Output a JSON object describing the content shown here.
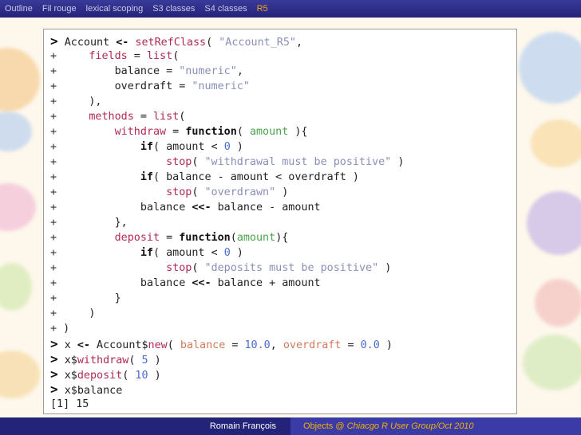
{
  "nav": {
    "items": [
      "Outline",
      "Fil rouge",
      "lexical scoping",
      "S3 classes",
      "S4 classes",
      "R5"
    ],
    "active_index": 5
  },
  "code": {
    "lines": [
      "> Account <- setRefClass( \"Account_R5\",",
      "+     fields = list(",
      "+         balance = \"numeric\",",
      "+         overdraft = \"numeric\"",
      "+     ),",
      "+     methods = list(",
      "+         withdraw = function( amount ){",
      "+             if( amount < 0 )",
      "+                 stop( \"withdrawal must be positive\" )",
      "+             if( balance - amount < overdraft )",
      "+                 stop( \"overdrawn\" )",
      "+             balance <<- balance - amount",
      "+         },",
      "+         deposit = function(amount){",
      "+             if( amount < 0 )",
      "+                 stop( \"deposits must be positive\" )",
      "+             balance <<- balance + amount",
      "+         }",
      "+     )",
      "+ )",
      "> x <- Account$new( balance = 10.0, overdraft = 0.0 )",
      "> x$withdraw( 5 )",
      "> x$deposit( 10 )",
      "> x$balance",
      "[1] 15"
    ]
  },
  "footer": {
    "author": "Romain François",
    "title_prefix": "Objects @",
    "title_event": "Chiacgo R User Group/Oct 2010"
  },
  "colors": {
    "nav_bg": "#23237a",
    "nav_active": "#f2a21a",
    "footer_left_bg": "#23237a",
    "footer_right_bg": "#3b3ba8",
    "footer_right_text": "#f2b000"
  }
}
